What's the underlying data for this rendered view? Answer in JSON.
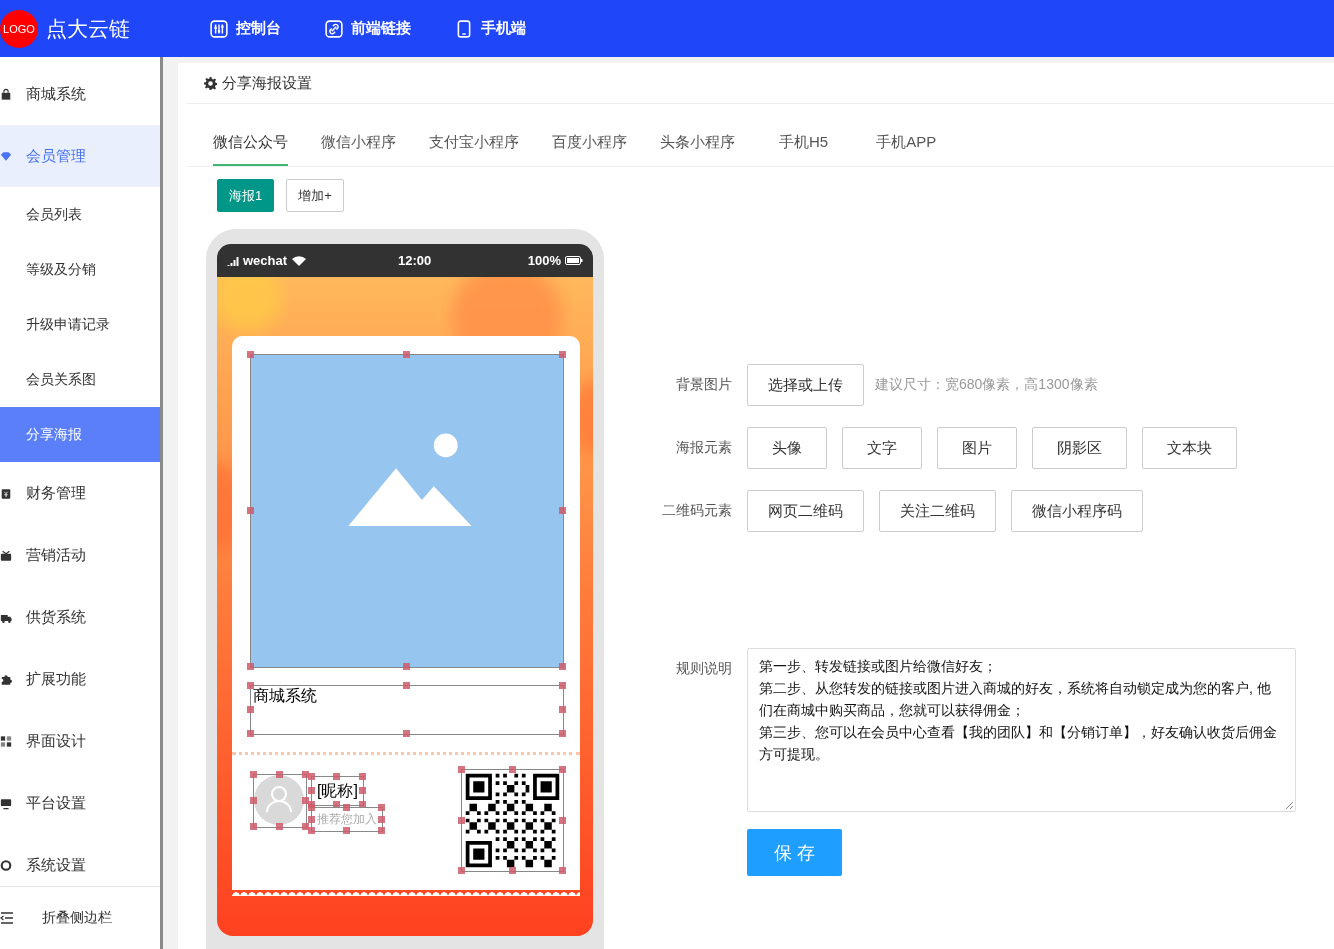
{
  "header": {
    "logo": "LOGO",
    "brand": "点大云链",
    "nav": [
      {
        "label": "控制台",
        "kind": "sliders"
      },
      {
        "label": "前端链接",
        "kind": "link"
      },
      {
        "label": "手机端",
        "kind": "phone"
      }
    ]
  },
  "sidebar": {
    "items": [
      {
        "label": "商城系统",
        "kind": "menu",
        "selected": false
      },
      {
        "label": "会员管理",
        "kind": "menu",
        "selected": true
      },
      {
        "label": "会员列表",
        "kind": "sub",
        "selected": false
      },
      {
        "label": "等级及分销",
        "kind": "sub",
        "selected": false
      },
      {
        "label": "升级申请记录",
        "kind": "sub",
        "selected": false
      },
      {
        "label": "会员关系图",
        "kind": "sub",
        "selected": false
      },
      {
        "label": "分享海报",
        "kind": "sub",
        "selected": true
      },
      {
        "label": "财务管理",
        "kind": "menu",
        "selected": false
      },
      {
        "label": "营销活动",
        "kind": "menu",
        "selected": false
      },
      {
        "label": "供货系统",
        "kind": "menu",
        "selected": false
      },
      {
        "label": "扩展功能",
        "kind": "menu",
        "selected": false
      },
      {
        "label": "界面设计",
        "kind": "menu",
        "selected": false
      },
      {
        "label": "平台设置",
        "kind": "menu",
        "selected": false
      },
      {
        "label": "系统设置",
        "kind": "menu",
        "selected": false
      }
    ],
    "collapse": "折叠侧边栏"
  },
  "page_title": "分享海报设置",
  "tabs": [
    {
      "label": "微信公众号",
      "selected": true
    },
    {
      "label": "微信小程序",
      "selected": false
    },
    {
      "label": "支付宝小程序",
      "selected": false
    },
    {
      "label": "百度小程序",
      "selected": false
    },
    {
      "label": "头条小程序",
      "selected": false
    },
    {
      "label": "手机H5",
      "selected": false
    },
    {
      "label": "手机APP",
      "selected": false
    }
  ],
  "posters": [
    {
      "label": "海报1",
      "selected": true
    }
  ],
  "add_button": "增加+",
  "phone": {
    "carrier": "wechat",
    "time": "12:00",
    "battery": "100%"
  },
  "poster": {
    "title": "商城系统",
    "nickname": "[昵称]",
    "invite": "推荐您加入"
  },
  "form": {
    "background": {
      "label": "背景图片",
      "button": "选择或上传",
      "hint": "建议尺寸：宽680像素，高1300像素"
    },
    "elements": {
      "label": "海报元素",
      "buttons": [
        "头像",
        "文字",
        "图片",
        "阴影区",
        "文本块"
      ]
    },
    "qrcodes": {
      "label": "二维码元素",
      "buttons": [
        "网页二维码",
        "关注二维码",
        "微信小程序码"
      ]
    },
    "rules": {
      "label": "规则说明",
      "lines": [
        "第一步、转发链接或图片给微信好友；",
        "第二步、从您转发的链接或图片进入商城的好友，系统将自动锁定成为您的客户, 他们在商城中购买商品，您就可以获得佣金；",
        "第三步、您可以在会员中心查看【我的团队】和【分销订单】，好友确认收货后佣金方可提现。"
      ]
    },
    "save": "保 存"
  }
}
